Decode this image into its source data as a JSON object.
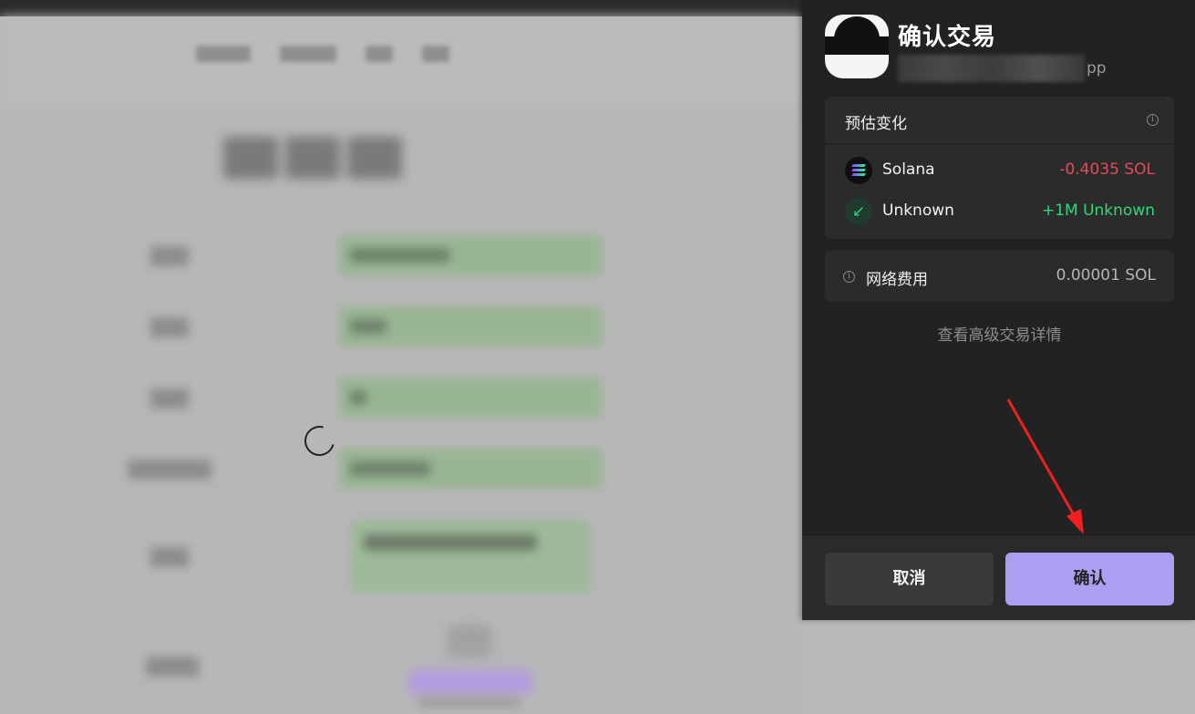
{
  "panel": {
    "title": "确认交易",
    "origin_suffix": "pp",
    "estimated_changes": {
      "title": "预估变化",
      "info_icon": "i",
      "assets": [
        {
          "name": "Solana",
          "change": "-0.4035 SOL",
          "icon": "solana-icon",
          "color": "#e54b5b"
        },
        {
          "name": "Unknown",
          "change": "+1M Unknown",
          "icon": "arrow-down-left-icon",
          "icon_glyph": "↙",
          "color": "#33d67a"
        }
      ]
    },
    "network_fee": {
      "label": "网络费用",
      "value": "0.00001 SOL",
      "info_icon": "i"
    },
    "advanced_link": "查看高级交易详情",
    "buttons": {
      "cancel": "取消",
      "confirm": "确认"
    }
  },
  "colors": {
    "accent": "#ab9ff2",
    "negative": "#e54b5b",
    "positive": "#33d67a",
    "panel_bg": "#222222"
  }
}
